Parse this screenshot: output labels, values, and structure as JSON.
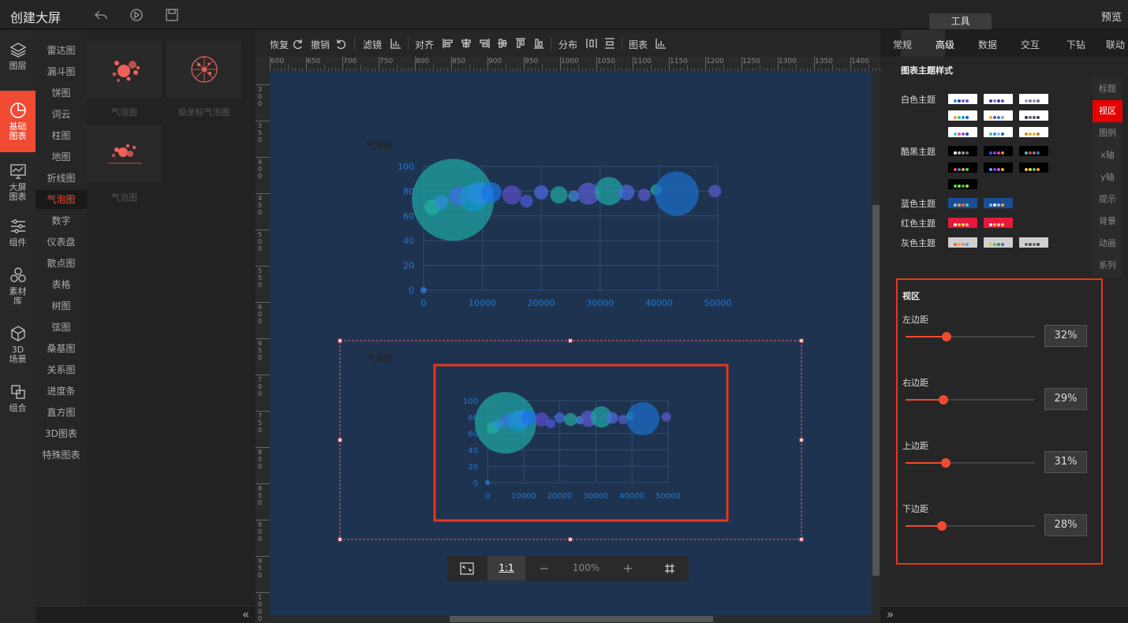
{
  "app": {
    "title": "创建大屏",
    "preview": "预览",
    "tools_tab": "工具"
  },
  "iconbar": [
    {
      "label": "图层"
    },
    {
      "label": "基础\n图表"
    },
    {
      "label": "大屏\n图表"
    },
    {
      "label": "组件"
    },
    {
      "label": "素材\n库"
    },
    {
      "label": "3D\n场景"
    },
    {
      "label": "组合"
    }
  ],
  "categories": [
    "雷达图",
    "漏斗图",
    "饼图",
    "词云",
    "柱图",
    "地图",
    "折线图",
    "气泡图",
    "数字",
    "仪表盘",
    "散点图",
    "表格",
    "树图",
    "弦图",
    "桑基图",
    "关系图",
    "进度条",
    "直方图",
    "3D图表",
    "特殊图表"
  ],
  "active_category": "气泡图",
  "thumbnails": [
    "气泡图",
    "极坐标气泡图",
    "气泡图"
  ],
  "toolbar": {
    "redo": "恢复",
    "undo": "撤销",
    "filter": "滤镜",
    "align": "对齐",
    "distribute": "分布",
    "chart": "图表"
  },
  "ruler": {
    "h": [
      "600",
      "650",
      "700",
      "750",
      "800",
      "850",
      "900",
      "950",
      "1000",
      "1050",
      "1100",
      "1150",
      "1200",
      "1250",
      "1300",
      "1350",
      "1400",
      "14"
    ],
    "v": [
      "300",
      "350",
      "400",
      "450",
      "500",
      "550",
      "600",
      "650",
      "700",
      "750",
      "800",
      "850",
      "900",
      "950",
      "1000",
      "1"
    ]
  },
  "chart_data": [
    {
      "type": "scatter",
      "title": "气泡图",
      "xlim": [
        0,
        50000
      ],
      "ylim": [
        0,
        100
      ],
      "x_ticks": [
        "0",
        "10000",
        "20000",
        "30000",
        "40000",
        "50000"
      ],
      "y_ticks": [
        "0",
        "20",
        "40",
        "60",
        "80",
        "100"
      ],
      "points": [
        {
          "x": 5000,
          "y": 73,
          "size": 52,
          "color": "#1fa5a5"
        },
        {
          "x": 1500,
          "y": 67,
          "size": 10,
          "color": "#20b0a0"
        },
        {
          "x": 3000,
          "y": 71,
          "size": 9,
          "color": "#2d8fd5"
        },
        {
          "x": 6000,
          "y": 76,
          "size": 12,
          "color": "#3d6ee8"
        },
        {
          "x": 8500,
          "y": 75,
          "size": 18,
          "color": "#1296c8"
        },
        {
          "x": 9500,
          "y": 78,
          "size": 15,
          "color": "#2a8ae0"
        },
        {
          "x": 11500,
          "y": 79,
          "size": 13,
          "color": "#1a73e8"
        },
        {
          "x": 15000,
          "y": 77,
          "size": 12,
          "color": "#5a4fc8"
        },
        {
          "x": 17500,
          "y": 72,
          "size": 8,
          "color": "#4a5ad8"
        },
        {
          "x": 20000,
          "y": 79,
          "size": 9,
          "color": "#4a6ae0"
        },
        {
          "x": 23000,
          "y": 77,
          "size": 11,
          "color": "#22a5a0"
        },
        {
          "x": 25500,
          "y": 76,
          "size": 7,
          "color": "#3d8fd5"
        },
        {
          "x": 28000,
          "y": 78,
          "size": 14,
          "color": "#5a5ad0"
        },
        {
          "x": 31500,
          "y": 80,
          "size": 18,
          "color": "#1fa5a5"
        },
        {
          "x": 34500,
          "y": 79,
          "size": 10,
          "color": "#4a6ae0"
        },
        {
          "x": 37500,
          "y": 77,
          "size": 8,
          "color": "#5a5ad0"
        },
        {
          "x": 39500,
          "y": 81,
          "size": 7,
          "color": "#22a5a0"
        },
        {
          "x": 43000,
          "y": 78,
          "size": 28,
          "color": "#1a6ec8"
        },
        {
          "x": 49500,
          "y": 80,
          "size": 8,
          "color": "#5a5ad0"
        },
        {
          "x": 0,
          "y": 0,
          "size": 4,
          "color": "#2d7fe0"
        }
      ]
    }
  ],
  "rightpanel": {
    "tabs": [
      "常规",
      "高级",
      "数据",
      "交互",
      "下钻",
      "联动"
    ],
    "active_tab": "高级",
    "section_title": "图表主题样式",
    "theme_groups": [
      "白色主题",
      "酷黑主题",
      "蓝色主题",
      "红色主题",
      "灰色主题"
    ],
    "sidenav": [
      "标题",
      "视区",
      "图例",
      "x轴",
      "y轴",
      "提示",
      "背景",
      "动画",
      "系列"
    ],
    "active_sidenav": "视区",
    "viewport": {
      "title": "视区",
      "sliders": [
        {
          "label": "左边距",
          "value": "32%",
          "fraction": 0.32
        },
        {
          "label": "右边距",
          "value": "29%",
          "fraction": 0.29
        },
        {
          "label": "上边距",
          "value": "31%",
          "fraction": 0.31
        },
        {
          "label": "下边距",
          "value": "28%",
          "fraction": 0.28
        }
      ]
    }
  },
  "zoom": {
    "ratio": "1:1",
    "level": "100%",
    "minus": "−",
    "plus": "+"
  },
  "colors": {
    "accent": "#f04a32",
    "canvas": "#1e3350",
    "highlight": "#e8361a",
    "active_nav": "#e60000"
  }
}
